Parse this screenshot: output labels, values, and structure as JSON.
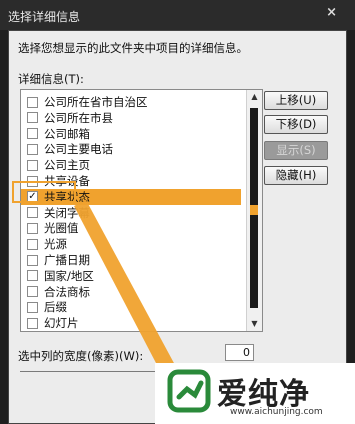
{
  "window": {
    "title": "选择详细信息",
    "close_glyph": "×"
  },
  "description": "选择您想显示的此文件夹中项目的详细信息。",
  "list_label": "详细信息(T):",
  "list": {
    "items": [
      {
        "label": "公司所在省市自治区",
        "checked": false
      },
      {
        "label": "公司所在市县",
        "checked": false
      },
      {
        "label": "公司邮箱",
        "checked": false
      },
      {
        "label": "公司主要电话",
        "checked": false
      },
      {
        "label": "公司主页",
        "checked": false
      },
      {
        "label": "共享设备",
        "checked": false
      },
      {
        "label": "共享状态",
        "checked": true,
        "selected": true
      },
      {
        "label": "关闭字幕",
        "checked": false
      },
      {
        "label": "光圈值",
        "checked": false
      },
      {
        "label": "光源",
        "checked": false
      },
      {
        "label": "广播日期",
        "checked": false
      },
      {
        "label": "国家/地区",
        "checked": false
      },
      {
        "label": "合法商标",
        "checked": false
      },
      {
        "label": "后缀",
        "checked": false
      },
      {
        "label": "幻灯片",
        "checked": false
      }
    ]
  },
  "buttons": {
    "move_up": "上移(U)",
    "move_down": "下移(D)",
    "show": "显示(S)",
    "hide": "隐藏(H)"
  },
  "width": {
    "label": "选中列的宽度(像素)(W):",
    "value": "0"
  },
  "watermark": {
    "brand": "爱纯净",
    "url": "www.aichunjing.com"
  },
  "colors": {
    "accent": "#f0a22e",
    "titlebar": "#2b2b2b",
    "panel": "#ececec"
  }
}
